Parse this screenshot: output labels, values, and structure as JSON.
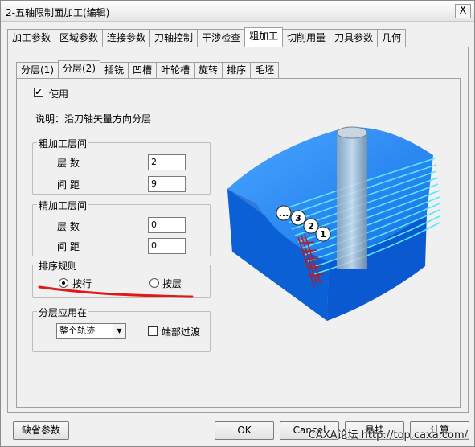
{
  "window": {
    "title": "2-五轴限制面加工(编辑)",
    "close_label": "X"
  },
  "tabs_top": [
    "加工参数",
    "区域参数",
    "连接参数",
    "刀轴控制",
    "干涉检查",
    "粗加工",
    "切削用量",
    "刀具参数",
    "几何"
  ],
  "tabs_sub": [
    "分层(1)",
    "分层(2)",
    "插铣",
    "凹槽",
    "叶轮槽",
    "旋转",
    "排序",
    "毛坯"
  ],
  "use_label": "使用",
  "description": "说明：沿刀轴矢量方向分层",
  "rough": {
    "title": "粗加工层间",
    "count_label": "层 数",
    "count_value": "2",
    "spacing_label": "间 距",
    "spacing_value": "9"
  },
  "finish": {
    "title": "精加工层间",
    "count_label": "层 数",
    "count_value": "0",
    "spacing_label": "间 距",
    "spacing_value": "0"
  },
  "sort": {
    "title": "排序规则",
    "by_row": "按行",
    "by_layer": "按层"
  },
  "apply": {
    "title": "分层应用在",
    "select_value": "整个轨迹",
    "transition_label": "端部过渡"
  },
  "preview_labels": [
    "...",
    "3",
    "2",
    "1"
  ],
  "buttons": {
    "defaults": "缺省参数",
    "ok": "OK",
    "cancel": "Cancel",
    "hang": "悬挂",
    "calc": "计算"
  },
  "watermark": "CAXA论坛 http://top.caxa.com/",
  "colors": {
    "block_top": "#2b8cf0",
    "block_side": "#0a55c8",
    "toolpath": "#56e8ff",
    "annotation_line": "#e01818"
  }
}
